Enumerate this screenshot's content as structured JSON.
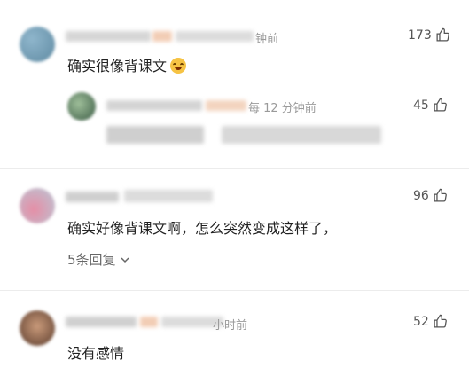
{
  "comments": [
    {
      "time_suffix": "钟前",
      "text": "确实很像背课文",
      "emoji": "laughing-tears-emoji",
      "likes": "173",
      "reply": {
        "time": "每 12 分钟前",
        "likes": "45"
      }
    },
    {
      "text": "确实好像背课文啊，怎么突然变成这样了，",
      "likes": "96",
      "replies_label": "5条回复"
    },
    {
      "time_suffix": "小时前",
      "text": "没有感情",
      "likes": "52"
    }
  ],
  "colors": {
    "meta": "#9a9a9a",
    "text": "#222222",
    "divider": "#ececec"
  }
}
